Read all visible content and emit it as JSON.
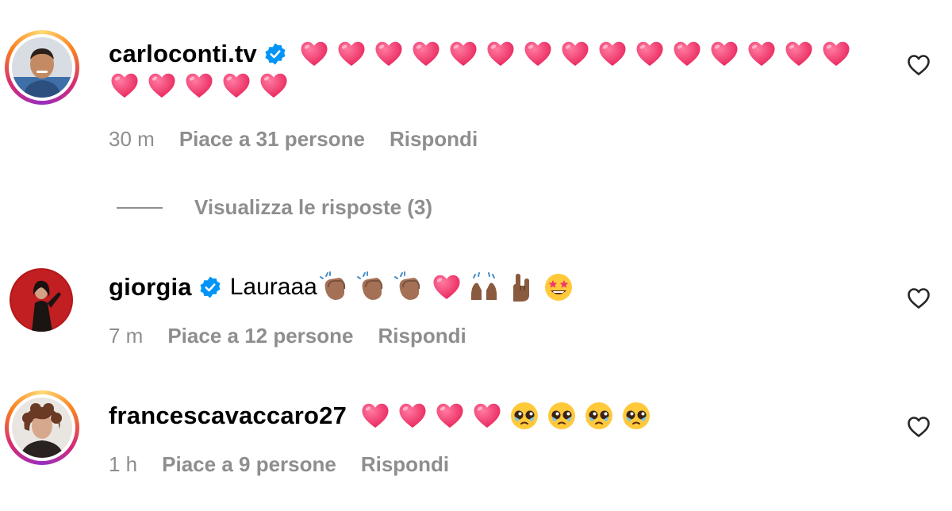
{
  "comments": [
    {
      "username": "carloconti.tv",
      "verified": true,
      "text": "",
      "emojis": [
        "heart",
        "heart",
        "heart",
        "heart",
        "heart",
        "heart",
        "heart",
        "heart",
        "heart",
        "heart",
        "heart",
        "heart",
        "heart",
        "heart",
        "heart",
        "heart",
        "heart",
        "heart",
        "heart",
        "heart"
      ],
      "time": "30 m",
      "likes": "Piace a 31 persone",
      "reply": "Rispondi",
      "view_replies": "Visualizza le risposte (3)"
    },
    {
      "username": "giorgia",
      "verified": true,
      "text": "Lauraaa",
      "emojis": [
        "clap",
        "clap",
        "clap",
        "heart",
        "raised-hands",
        "horns",
        "star-eyes"
      ],
      "time": "7 m",
      "likes": "Piace a 12 persone",
      "reply": "Rispondi"
    },
    {
      "username": "francescavaccaro27",
      "verified": false,
      "text": "",
      "emojis": [
        "heart",
        "heart",
        "heart",
        "heart",
        "teary-face",
        "teary-face",
        "teary-face",
        "teary-face"
      ],
      "time": "1 h",
      "likes": "Piace a 9 persone",
      "reply": "Rispondi"
    }
  ],
  "icons": {
    "like": "heart-outline-icon",
    "verified": "verified-badge-icon"
  },
  "colors": {
    "verified": "#0095f6",
    "secondary_text": "#8e8e8e",
    "heart": "#f0386b"
  }
}
